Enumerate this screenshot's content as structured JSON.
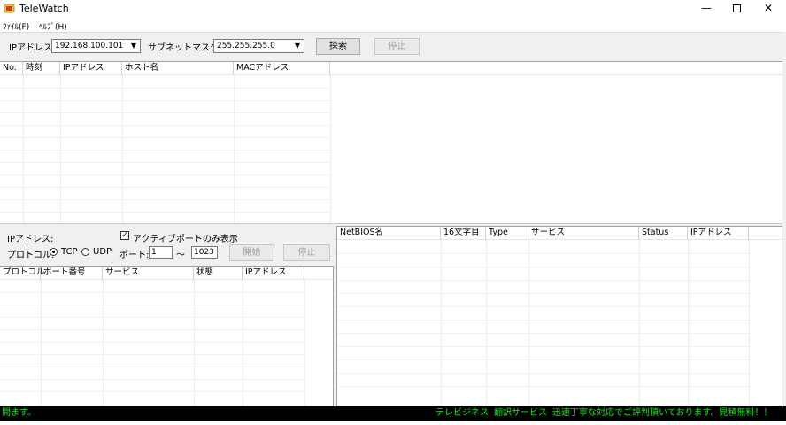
{
  "window": {
    "title": "TeleWatch"
  },
  "menu": {
    "file": "ﾌｧｲﾙ(F)",
    "help": "ﾍﾙﾌﾟ(H)"
  },
  "toolbar": {
    "ip_label": "IPアドレス:",
    "ip_value": "192.168.100.101",
    "subnet_label": "サブネットマスク:",
    "subnet_value": "255.255.255.0",
    "search_button": "探索",
    "stop_button": "停止"
  },
  "host_table": {
    "columns": [
      "No.",
      "時刻",
      "IPアドレス",
      "ホスト名",
      "MACアドレス"
    ],
    "rows": []
  },
  "port_panel": {
    "ip_label": "IPアドレス:",
    "active_only_label": "アクティブポートのみ表示",
    "active_only_checked": true,
    "protocol_label": "プロトコル:",
    "tcp_label": "TCP",
    "udp_label": "UDP",
    "selected_protocol": "TCP",
    "port_label": "ポート:",
    "port_from": "1",
    "tilde": "〜",
    "port_to": "1023",
    "start_button": "開始",
    "stop_button": "停止"
  },
  "port_table": {
    "columns": [
      "プロトコル",
      "ポート番号",
      "サービス",
      "状態",
      "IPアドレス"
    ],
    "rows": []
  },
  "netbios_table": {
    "columns": [
      "NetBIOS名",
      "16文字目",
      "Type",
      "サービス",
      "Status",
      "IPアドレス"
    ],
    "rows": []
  },
  "status": {
    "left_text": "開ます。",
    "right_text": "テレビジネス 翻訳サービス 迅速丁寧な対応でご評判頂いております。見積無料！！"
  }
}
